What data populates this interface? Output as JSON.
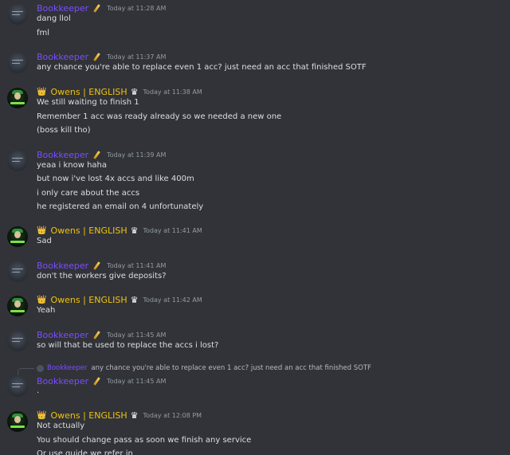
{
  "channel": {
    "messages": [
      {
        "author": "Bookkeeper",
        "role": "user",
        "time": "Today at 11:28 AM",
        "lines": [
          "dang llol",
          "fml"
        ]
      },
      {
        "author": "Bookkeeper",
        "role": "user",
        "time": "Today at 11:37 AM",
        "lines": [
          "any chance you're able to replace even 1 acc? just need an acc that finished SOTF"
        ]
      },
      {
        "author": "Owens | ENGLISH",
        "role": "owner",
        "time": "Today at 11:38 AM",
        "lines": [
          "We still waiting to finish 1",
          "Remember 1 acc was ready already so we needed a new one",
          "(boss kill tho)"
        ]
      },
      {
        "author": "Bookkeeper",
        "role": "user",
        "time": "Today at 11:39 AM",
        "lines": [
          "yeaa i know haha",
          "but now i've lost 4x accs and like 400m",
          "i only care about the accs",
          "he registered an email on 4 unfortunately"
        ]
      },
      {
        "author": "Owens | ENGLISH",
        "role": "owner",
        "time": "Today at 11:41 AM",
        "lines": [
          "Sad"
        ]
      },
      {
        "author": "Bookkeeper",
        "role": "user",
        "time": "Today at 11:41 AM",
        "lines": [
          "don't the workers give deposits?"
        ]
      },
      {
        "author": "Owens | ENGLISH",
        "role": "owner",
        "time": "Today at 11:42 AM",
        "lines": [
          "Yeah"
        ]
      },
      {
        "author": "Bookkeeper",
        "role": "user",
        "time": "Today at 11:45 AM",
        "lines": [
          "so will that be used to replace the accs i lost?"
        ]
      },
      {
        "author": "Bookkeeper",
        "role": "user",
        "time": "Today at 11:45 AM",
        "reply_to": {
          "author": "Bookkeeper",
          "text": "any chance you're able to replace even 1 acc? just need an acc that finished SOTF"
        },
        "lines": [
          "."
        ]
      },
      {
        "author": "Owens | ENGLISH",
        "role": "owner",
        "time": "Today at 12:08 PM",
        "lines": [
          "Not actually",
          "You should change pass as soon we finish any service",
          "Or use guide we refer in"
        ]
      }
    ]
  },
  "badges": {
    "owner_prefix_icon": "crown-icon",
    "owner_prefix_glyph": "👑",
    "owner_suffix_icon": "crown-outline-icon",
    "owner_suffix_glyph": "♛",
    "user_suffix_icon": "quill-icon"
  },
  "colors": {
    "background": "#313338",
    "user_name": "#7c4dff",
    "owner_name": "#f0c20f",
    "text": "#dbdee1",
    "timestamp": "#949ba4"
  }
}
